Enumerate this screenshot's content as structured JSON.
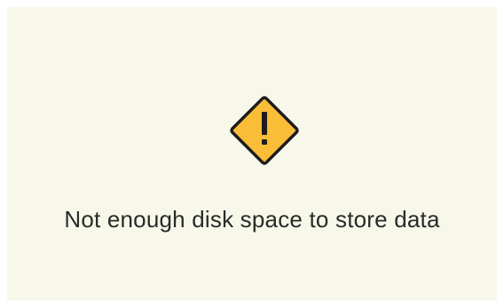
{
  "error": {
    "icon": "warning-diamond-icon",
    "icon_color": "#F9BD38",
    "icon_outline_color": "#1C1C1C",
    "message": "Not enough disk space to store data"
  },
  "colors": {
    "background": "#F8F8EA",
    "text": "#2A2A2A"
  }
}
